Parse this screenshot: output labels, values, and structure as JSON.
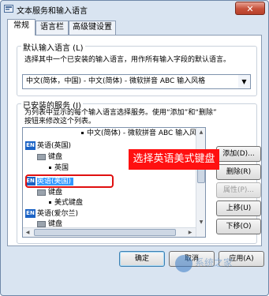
{
  "window": {
    "title": "文本服务和输入语言",
    "close_label": "✕"
  },
  "tabs": [
    {
      "label": "常规",
      "active": true
    },
    {
      "label": "语言栏",
      "active": false
    },
    {
      "label": "高级键设置",
      "active": false
    }
  ],
  "default_language": {
    "legend": "默认输入语言 (L)",
    "description": "选择其中一个已安装的输入语言，用作所有输入字段的默认语言。",
    "selected": "中文(简体，中国) - 中文(简体) - 微软拼音 ABC 输入风格"
  },
  "installed_services": {
    "legend": "已安装的服务 (I)",
    "description_line1": "为列表中显示的每个输入语言选择服务。使用“添加”和“删除”",
    "description_line2": "按钮来修改这个列表。",
    "tree": [
      {
        "kind": "service",
        "text": "中文(简体) - 微软拼音 ABC 输入风格"
      },
      {
        "kind": "language",
        "badge": "EN",
        "text": "英语(英国)"
      },
      {
        "kind": "group",
        "text": "键盘"
      },
      {
        "kind": "service",
        "text": "英国"
      },
      {
        "kind": "language",
        "badge": "EN",
        "text": "英语(美国)",
        "selected": true
      },
      {
        "kind": "group",
        "text": "键盘"
      },
      {
        "kind": "service",
        "text": "美式键盘"
      },
      {
        "kind": "language",
        "badge": "EN",
        "text": "英语(爱尔兰)"
      },
      {
        "kind": "group",
        "text": "键盘"
      },
      {
        "kind": "service",
        "text": "爱尔兰语"
      }
    ],
    "buttons": {
      "add": "添加(D)...",
      "remove": "删除(R)",
      "properties": "属性(P)...",
      "move_up": "上移(U)",
      "move_down": "下移(O)"
    }
  },
  "annotation": {
    "callout_text": "选择英语美式键盘"
  },
  "footer": {
    "ok": "确定",
    "cancel": "取消",
    "apply": "应用(A)"
  },
  "watermark": {
    "text": "系统之家"
  },
  "colors": {
    "callout": "#ff1010",
    "selection": "#3399ff",
    "lang_badge": "#1b63c5"
  }
}
